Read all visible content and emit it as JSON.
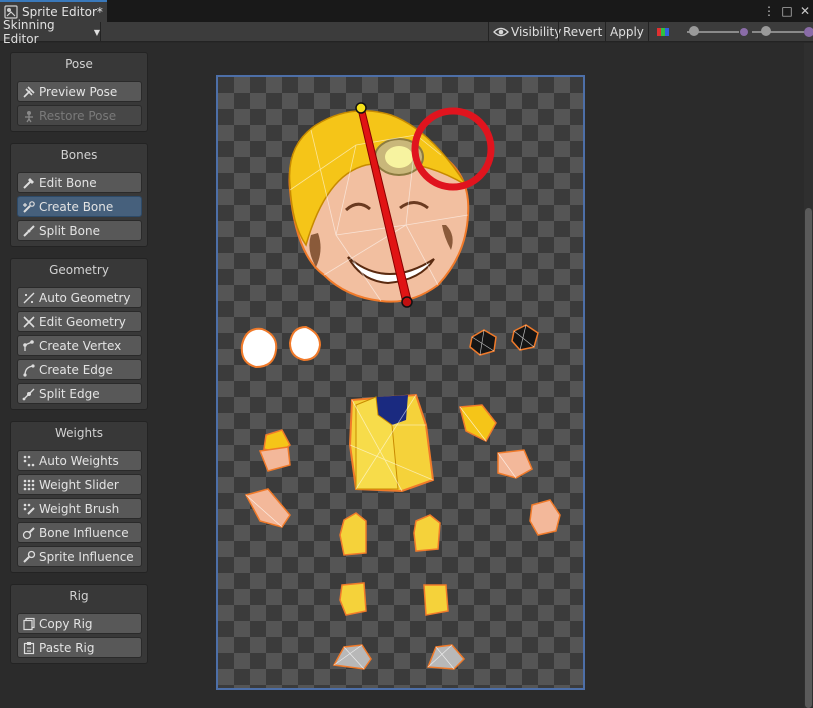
{
  "window": {
    "tab_title": "Sprite Editor*",
    "controls": {
      "more": "⋮",
      "maximize": "□",
      "close": "✕"
    }
  },
  "toolbar": {
    "mode": "Skinning Editor",
    "visibility": "Visibility",
    "revert": "Revert",
    "apply": "Apply",
    "zoom_level": 0.05,
    "brush_level": 0.2
  },
  "panels": [
    {
      "title": "Pose",
      "tools": [
        {
          "label": "Preview Pose",
          "icon": "preview-pose-icon",
          "state": "normal"
        },
        {
          "label": "Restore Pose",
          "icon": "restore-pose-icon",
          "state": "disabled"
        }
      ]
    },
    {
      "title": "Bones",
      "tools": [
        {
          "label": "Edit Bone",
          "icon": "edit-bone-icon",
          "state": "normal"
        },
        {
          "label": "Create Bone",
          "icon": "create-bone-icon",
          "state": "active"
        },
        {
          "label": "Split Bone",
          "icon": "split-bone-icon",
          "state": "normal"
        }
      ]
    },
    {
      "title": "Geometry",
      "tools": [
        {
          "label": "Auto Geometry",
          "icon": "auto-geometry-icon",
          "state": "normal"
        },
        {
          "label": "Edit Geometry",
          "icon": "edit-geometry-icon",
          "state": "normal"
        },
        {
          "label": "Create Vertex",
          "icon": "create-vertex-icon",
          "state": "normal"
        },
        {
          "label": "Create Edge",
          "icon": "create-edge-icon",
          "state": "normal"
        },
        {
          "label": "Split Edge",
          "icon": "split-edge-icon",
          "state": "normal"
        }
      ]
    },
    {
      "title": "Weights",
      "tools": [
        {
          "label": "Auto Weights",
          "icon": "auto-weights-icon",
          "state": "normal"
        },
        {
          "label": "Weight Slider",
          "icon": "weight-slider-icon",
          "state": "normal"
        },
        {
          "label": "Weight Brush",
          "icon": "weight-brush-icon",
          "state": "normal"
        },
        {
          "label": "Bone Influence",
          "icon": "bone-influence-icon",
          "state": "normal"
        },
        {
          "label": "Sprite Influence",
          "icon": "sprite-influence-icon",
          "state": "normal"
        }
      ]
    },
    {
      "title": "Rig",
      "tools": [
        {
          "label": "Copy Rig",
          "icon": "copy-rig-icon",
          "state": "normal"
        },
        {
          "label": "Paste Rig",
          "icon": "paste-rig-icon",
          "state": "normal"
        }
      ]
    }
  ],
  "colors": {
    "accent_active": "#46607c",
    "sprite_outline": "#f07a2a",
    "bone": "#e01414",
    "highlight_circle": "#e0141e",
    "helmet_yellow": "#f5c518"
  }
}
